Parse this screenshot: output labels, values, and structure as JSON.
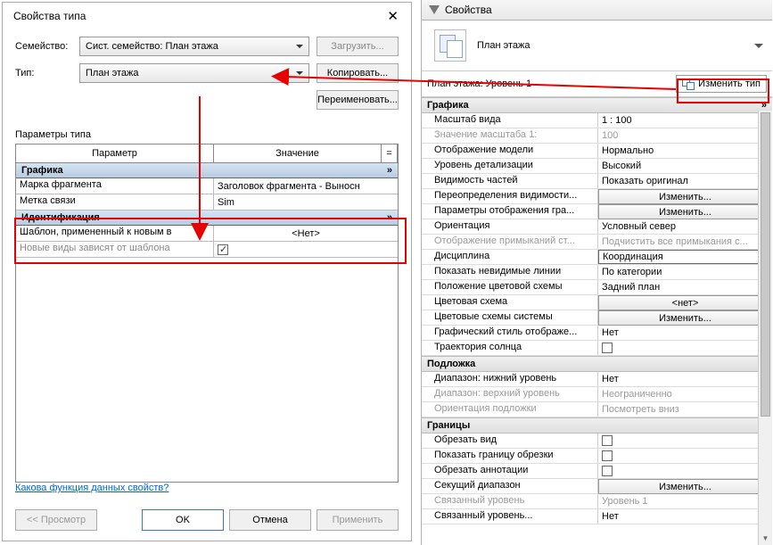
{
  "dialog": {
    "title": "Свойства типа",
    "family_label": "Семейство:",
    "family_value": "Сист. семейство: План этажа",
    "type_label": "Тип:",
    "type_value": "План этажа",
    "btn_load": "Загрузить...",
    "btn_copy": "Копировать...",
    "btn_rename": "Переименовать...",
    "params_label": "Параметры типа",
    "th_param": "Параметр",
    "th_value": "Значение",
    "th_eq": "=",
    "group_graphics": "Графика",
    "group_identity": "Идентификация",
    "rows_graphics": [
      {
        "p": "Марка фрагмента",
        "v": "Заголовок фрагмента - Выносн"
      },
      {
        "p": "Метка связи",
        "v": "Sim"
      }
    ],
    "rows_identity": [
      {
        "p": "Шаблон, примененный к новым в",
        "v": "<Нет>",
        "center": true
      },
      {
        "p": "Новые виды зависят от шаблона",
        "v": "checkbox",
        "grey": true
      }
    ],
    "help_link": "Какова функция данных свойств?",
    "btn_preview": "<< Просмотр",
    "btn_ok": "OK",
    "btn_cancel": "Отмена",
    "btn_apply": "Применить"
  },
  "palette": {
    "title": "Свойства",
    "head_label": "План этажа",
    "selector": "План этажа: Уровень 1",
    "edit_type": "Изменить тип",
    "groups": [
      {
        "name": "Графика",
        "rows": [
          {
            "k": "Масштаб вида",
            "v": "1 : 100"
          },
          {
            "k": "Значение масштаба    1:",
            "v": "100",
            "grey": true
          },
          {
            "k": "Отображение модели",
            "v": "Нормально"
          },
          {
            "k": "Уровень детализации",
            "v": "Высокий"
          },
          {
            "k": "Видимость частей",
            "v": "Показать оригинал"
          },
          {
            "k": "Переопределения видимости...",
            "v": "Изменить...",
            "btn": true
          },
          {
            "k": "Параметры отображения гра...",
            "v": "Изменить...",
            "btn": true
          },
          {
            "k": "Ориентация",
            "v": "Условный север"
          },
          {
            "k": "Отображение примыканий ст...",
            "v": "Подчистить все примыкания с...",
            "grey": true
          },
          {
            "k": "Дисциплина",
            "v": "Координация",
            "boxed": true
          },
          {
            "k": "Показать невидимые линии",
            "v": "По категории"
          },
          {
            "k": "Положение цветовой схемы",
            "v": "Задний план"
          },
          {
            "k": "Цветовая схема",
            "v": "<нет>",
            "btn": true
          },
          {
            "k": "Цветовые схемы системы",
            "v": "Изменить...",
            "btn": true
          },
          {
            "k": "Графический стиль отображе...",
            "v": "Нет"
          },
          {
            "k": "Траектория солнца",
            "v": "checkbox"
          }
        ]
      },
      {
        "name": "Подложка",
        "rows": [
          {
            "k": "Диапазон: нижний уровень",
            "v": "Нет"
          },
          {
            "k": "Диапазон: верхний уровень",
            "v": "Неограниченно",
            "grey": true
          },
          {
            "k": "Ориентация подложки",
            "v": "Посмотреть вниз",
            "grey": true
          }
        ]
      },
      {
        "name": "Границы",
        "rows": [
          {
            "k": "Обрезать вид",
            "v": "checkbox"
          },
          {
            "k": "Показать границу обрезки",
            "v": "checkbox"
          },
          {
            "k": "Обрезать аннотации",
            "v": "checkbox"
          },
          {
            "k": "Секущий диапазон",
            "v": "Изменить...",
            "btn": true
          },
          {
            "k": "Связанный уровень",
            "v": "Уровень 1",
            "grey": true
          },
          {
            "k": "Связанный уровень...",
            "v": "Нет"
          }
        ]
      }
    ]
  }
}
